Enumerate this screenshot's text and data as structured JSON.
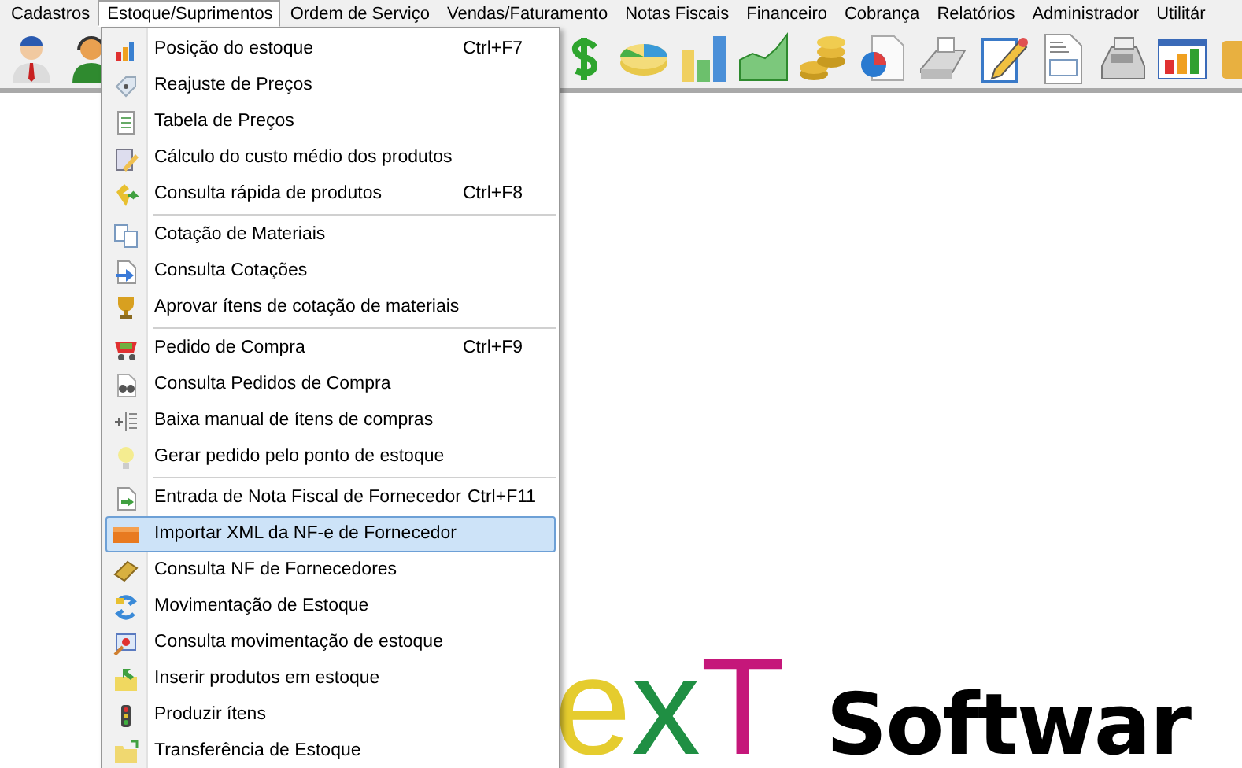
{
  "menu_bar": [
    {
      "label": "Cadastros",
      "selected": false
    },
    {
      "label": "Estoque/Suprimentos",
      "selected": true
    },
    {
      "label": "Ordem de Serviço",
      "selected": false
    },
    {
      "label": "Vendas/Faturamento",
      "selected": false
    },
    {
      "label": "Notas Fiscais",
      "selected": false
    },
    {
      "label": "Financeiro",
      "selected": false
    },
    {
      "label": "Cobrança",
      "selected": false
    },
    {
      "label": "Relatórios",
      "selected": false
    },
    {
      "label": "Administrador",
      "selected": false
    },
    {
      "label": "Utilitár",
      "selected": false
    }
  ],
  "open_menu": {
    "sections": [
      {
        "items": [
          {
            "label": "Posição do estoque",
            "shortcut": "Ctrl+F7",
            "selected": false
          },
          {
            "label": "Reajuste de Preços",
            "selected": false
          },
          {
            "label": "Tabela de Preços",
            "selected": false
          },
          {
            "label": "Cálculo do custo médio dos produtos",
            "selected": false
          },
          {
            "label": "Consulta rápida de produtos",
            "shortcut": "Ctrl+F8",
            "selected": false
          }
        ]
      },
      {
        "items": [
          {
            "label": "Cotação de Materiais",
            "selected": false
          },
          {
            "label": "Consulta Cotações",
            "selected": false
          },
          {
            "label": "Aprovar ítens de cotação de materiais",
            "selected": false
          }
        ]
      },
      {
        "items": [
          {
            "label": "Pedido de Compra",
            "shortcut": "Ctrl+F9",
            "selected": false
          },
          {
            "label": "Consulta Pedidos de Compra",
            "selected": false
          },
          {
            "label": "Baixa manual de ítens de compras",
            "selected": false
          },
          {
            "label": "Gerar pedido pelo ponto de estoque",
            "selected": false
          }
        ]
      },
      {
        "items": [
          {
            "label": "Entrada de Nota Fiscal de Fornecedor",
            "shortcut": "Ctrl+F11",
            "selected": false
          },
          {
            "label": "Importar XML da NF-e de Fornecedor",
            "selected": true
          },
          {
            "label": "Consulta NF de Fornecedores",
            "selected": false
          },
          {
            "label": "Movimentação de Estoque",
            "selected": false
          },
          {
            "label": "Consulta movimentação de estoque",
            "selected": false
          },
          {
            "label": "Inserir produtos em estoque",
            "selected": false
          },
          {
            "label": "Produzir ítens",
            "selected": false
          },
          {
            "label": "Transferência de Estoque",
            "selected": false
          }
        ]
      }
    ]
  },
  "logo": {
    "letters": [
      {
        "text": "e",
        "color": "#e5cc2e"
      },
      {
        "text": "x",
        "color": "#1f8f43"
      },
      {
        "text": "T",
        "color": "#c5177a"
      }
    ],
    "word": "Softwar"
  }
}
